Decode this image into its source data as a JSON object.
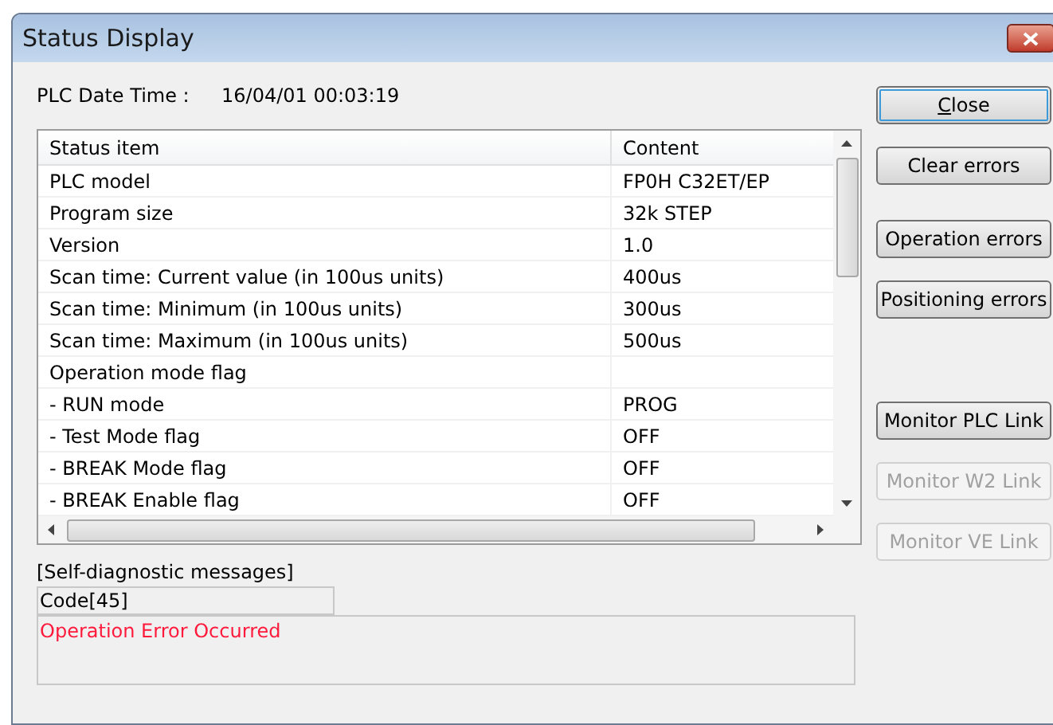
{
  "window": {
    "title": "Status Display"
  },
  "plc_date_time": {
    "label": "PLC Date Time :",
    "value": "16/04/01 00:03:19"
  },
  "table": {
    "columns": [
      "Status item",
      "Content"
    ],
    "rows": [
      {
        "item": "PLC model",
        "content": "FP0H C32ET/EP"
      },
      {
        "item": "Program size",
        "content": "32k STEP"
      },
      {
        "item": "Version",
        "content": "1.0"
      },
      {
        "item": "Scan time: Current value (in 100us units)",
        "content": "400us"
      },
      {
        "item": "Scan time: Minimum (in 100us units)",
        "content": "300us"
      },
      {
        "item": "Scan time: Maximum (in 100us units)",
        "content": "500us"
      },
      {
        "item": "Operation mode flag"
      },
      {
        "item": "- RUN mode",
        "content": "PROG"
      },
      {
        "item": "- Test Mode flag",
        "content": "OFF"
      },
      {
        "item": "- BREAK Mode flag",
        "content": "OFF"
      },
      {
        "item": "- BREAK Enable flag",
        "content": "OFF"
      }
    ]
  },
  "diagnostics": {
    "heading": "[Self-diagnostic messages]",
    "code": "Code[45]",
    "message": "Operation Error Occurred"
  },
  "buttons": [
    {
      "label": "Close",
      "first_letter_underlined": true,
      "disabled": false,
      "focused": true
    },
    {
      "label": "Clear errors",
      "disabled": false,
      "focused": false
    },
    {
      "label": "Operation errors",
      "disabled": false,
      "focused": false
    },
    {
      "label": "Positioning errors",
      "disabled": false,
      "focused": false
    },
    {
      "label": "Monitor PLC Link",
      "disabled": false,
      "focused": false
    },
    {
      "label": "Monitor W2 Link",
      "disabled": true,
      "focused": false
    },
    {
      "label": "Monitor VE Link",
      "disabled": true,
      "focused": false
    }
  ]
}
